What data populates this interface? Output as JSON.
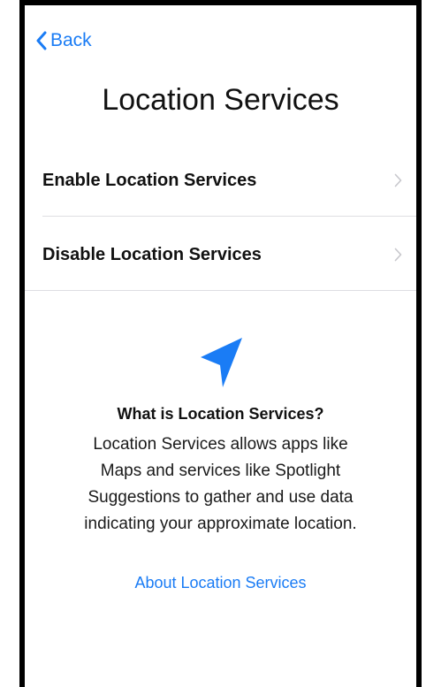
{
  "nav": {
    "back_label": "Back"
  },
  "page": {
    "title": "Location Services"
  },
  "options": [
    {
      "label": "Enable Location Services"
    },
    {
      "label": "Disable Location Services"
    }
  ],
  "info": {
    "icon": "location-arrow-icon",
    "heading": "What is Location Services?",
    "body_lines": [
      "Location Services allows apps like",
      "Maps and services like Spotlight",
      "Suggestions to gather and use data",
      "indicating your approximate location."
    ],
    "link_label": "About Location Services"
  },
  "colors": {
    "accent": "#1a7cf5",
    "separator": "#dedee2",
    "chevron": "#c7c7cc"
  }
}
